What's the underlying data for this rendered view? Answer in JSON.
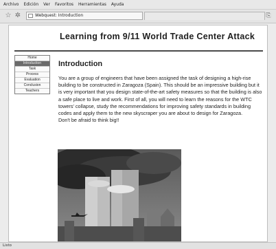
{
  "menu": [
    "Archivo",
    "Edición",
    "Ver",
    "Favoritos",
    "Herramientas",
    "Ayuda"
  ],
  "toolbar": {
    "address": "Webquest: Introduction",
    "icons": [
      "star-icon",
      "gear-icon",
      "page-icon"
    ]
  },
  "page": {
    "title": "Learning from 9/11 World Trade Center Attack",
    "nav": [
      "Home",
      "Introduction",
      "Task",
      "Process",
      "Evaluation",
      "Conclusion",
      "Teachers"
    ],
    "active_nav": "Introduction",
    "heading": "Introduction",
    "paragraph1": "You are a group of engineers that have been assigned the task of designing a high-rise building to be constructed in Zaragoza (Spain). This should be an impressive building but it is very important that you design state-of-the-art safety measures  so that the building is also a safe place to live and work. First of all, you will need to learn the reasons for the WTC towers' collapse, study the recommendations for improving safety standards in building codes and apply them to the new skyscraper you are about to design for Zaragoza.",
    "paragraph2": "Don't be afraid to think big!!"
  },
  "status": "Listo"
}
